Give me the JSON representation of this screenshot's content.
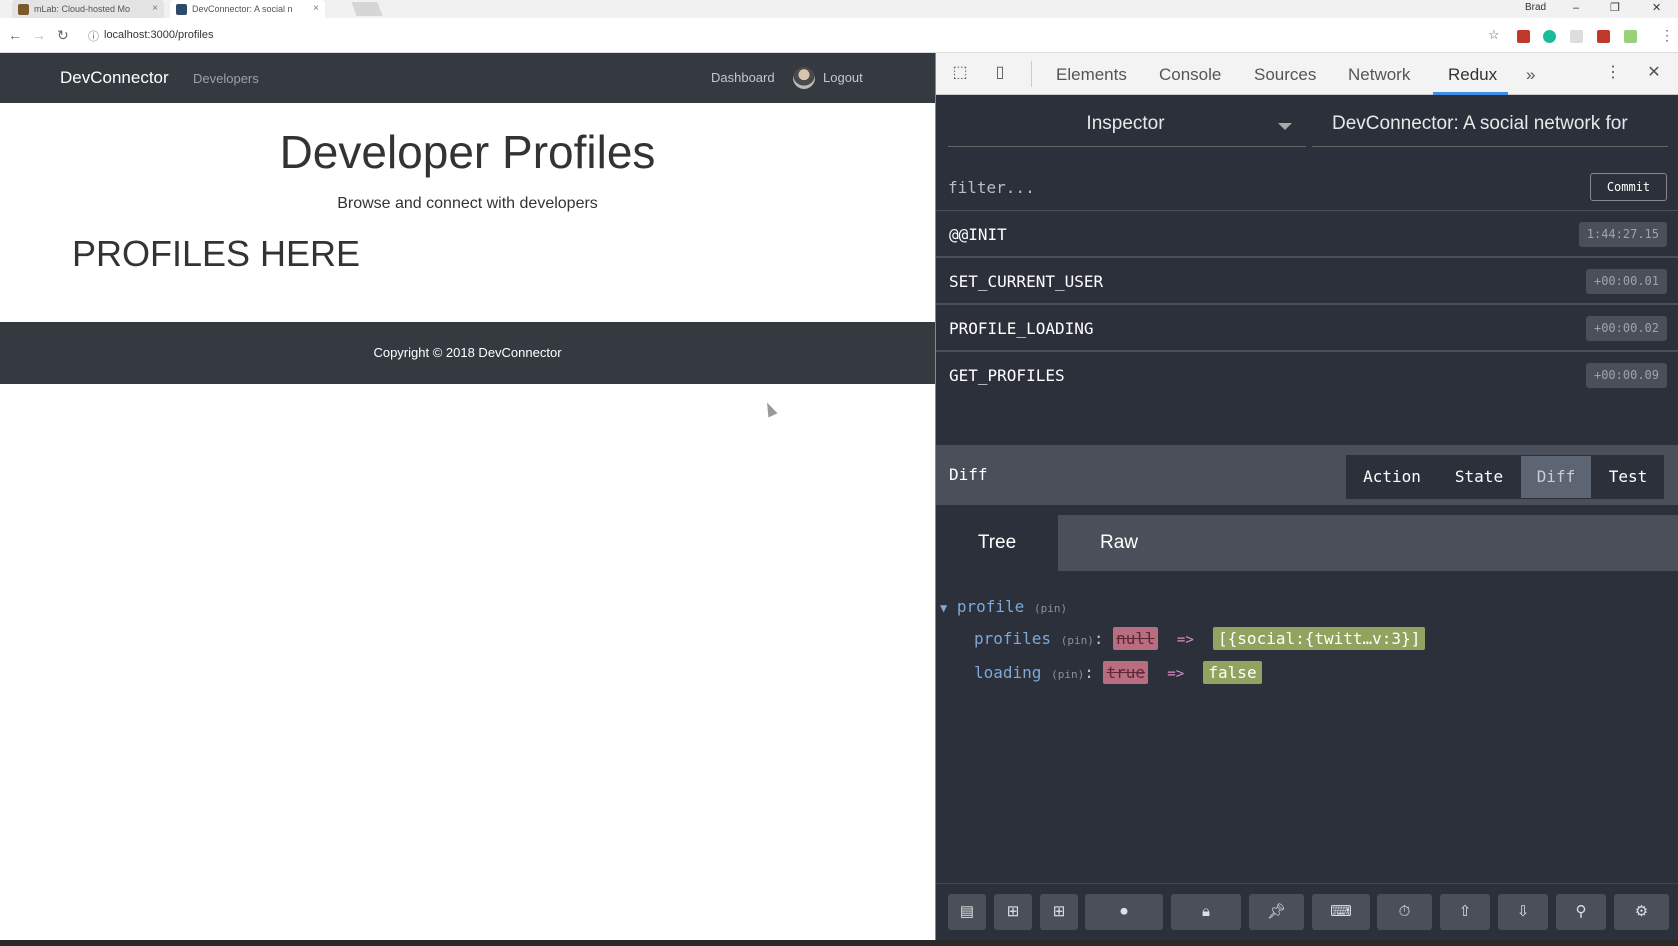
{
  "browser": {
    "tabs": [
      {
        "label": "mLab: Cloud-hosted Mo",
        "fav_color": "#7a5a2a"
      },
      {
        "label": "DevConnector: A social n",
        "fav_color": "#2e4a6a"
      }
    ],
    "user": "Brad",
    "url": "localhost:3000/profiles"
  },
  "page": {
    "brand": "DevConnector",
    "nav_developers": "Developers",
    "nav_dashboard": "Dashboard",
    "nav_logout": "Logout",
    "title": "Developer Profiles",
    "subtitle": "Browse and connect with developers",
    "profiles_placeholder": "PROFILES HERE",
    "footer": "Copyright © 2018 DevConnector"
  },
  "devtools": {
    "tabs": [
      "Elements",
      "Console",
      "Sources",
      "Network",
      "Redux"
    ],
    "active_tab": "Redux",
    "more": "»",
    "inspector": "Inspector",
    "instance": "DevConnector: A social network for",
    "filter_placeholder": "filter...",
    "commit": "Commit",
    "actions": [
      {
        "name": "@@INIT",
        "time": "1:44:27.15"
      },
      {
        "name": "SET_CURRENT_USER",
        "time": "+00:00.01"
      },
      {
        "name": "PROFILE_LOADING",
        "time": "+00:00.02"
      },
      {
        "name": "GET_PROFILES",
        "time": "+00:00.09"
      }
    ],
    "diff_title": "Diff",
    "monitor_tabs": [
      "Action",
      "State",
      "Diff",
      "Test"
    ],
    "active_monitor": "Diff",
    "subtabs": [
      "Tree",
      "Raw"
    ],
    "active_subtab": "Tree",
    "tree": {
      "root_key": "profile",
      "pin": "(pin)",
      "rows": [
        {
          "key": "profiles",
          "old": "null",
          "new": "[{social:{twitt…v:3}]"
        },
        {
          "key": "loading",
          "old": "true",
          "new": "false"
        }
      ],
      "arrow": "=>"
    }
  }
}
